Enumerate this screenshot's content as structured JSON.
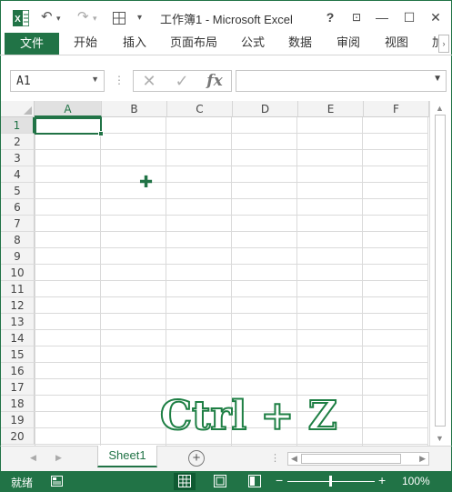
{
  "window": {
    "title": "工作簿1 - Microsoft Excel",
    "help_label": "?",
    "minimize_label": "—",
    "maximize_label": "☐",
    "close_label": "✕"
  },
  "quick_access": {
    "undo_label": "↶",
    "redo_label": "↷",
    "view_icon": "table-icon",
    "more_label": "▾"
  },
  "ribbon": {
    "file_tab": "文件",
    "tabs": [
      "开始",
      "插入",
      "页面布局",
      "公式",
      "数据",
      "审阅",
      "视图",
      "加"
    ]
  },
  "formula_bar": {
    "name_box": "A1",
    "cancel_icon": "cancel-icon",
    "enter_icon": "check-icon",
    "fx_label": "fx",
    "formula": ""
  },
  "grid": {
    "columns": [
      "A",
      "B",
      "C",
      "D",
      "E",
      "F"
    ],
    "rows": [
      "1",
      "2",
      "3",
      "4",
      "5",
      "6",
      "7",
      "8",
      "9",
      "10",
      "11",
      "12",
      "13",
      "14",
      "15",
      "16",
      "17",
      "18",
      "19",
      "20"
    ],
    "active_cell": "A1"
  },
  "overlay_caption": "Ctrl + Z",
  "sheets": {
    "tabs": [
      "Sheet1"
    ],
    "active": "Sheet1"
  },
  "status": {
    "ready": "就绪",
    "zoom": "100%",
    "accent": "#217346"
  }
}
